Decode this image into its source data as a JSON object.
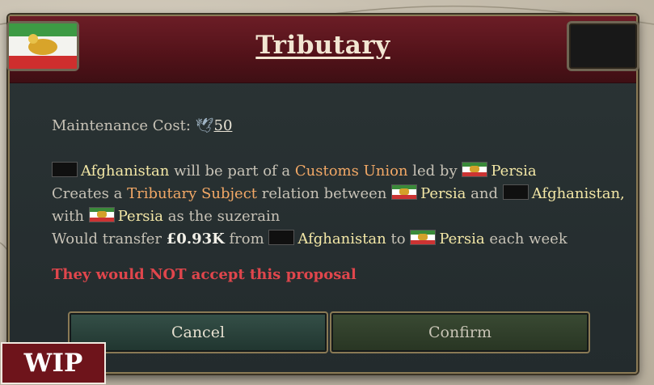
{
  "dialog": {
    "title": "Tributary",
    "maintenance_label": "Maintenance Cost:",
    "maintenance_value": "50",
    "line1": {
      "country_a": "Afghanistan",
      "text1": "will be part of a",
      "union": "Customs Union",
      "text2": "led by",
      "country_b": "Persia"
    },
    "line2": {
      "text1": "Creates a",
      "relation": "Tributary Subject",
      "text2": "relation between",
      "country_b": "Persia",
      "text3": "and",
      "country_a": "Afghanistan,"
    },
    "line3": {
      "text1": "with",
      "country_b": "Persia",
      "text2": "as the suzerain"
    },
    "line4": {
      "text1": "Would transfer",
      "currency": "£",
      "amount": "0.93K",
      "text2": "from",
      "country_a": "Afghanistan",
      "text3": "to",
      "country_b": "Persia",
      "text4": "each week"
    },
    "refusal": "They would NOT accept this proposal",
    "cancel_label": "Cancel",
    "confirm_label": "Confirm"
  },
  "badge": {
    "label": "WIP"
  },
  "icons": {
    "maintenance": "dove-icon",
    "persia_flag": "persia-flag-icon",
    "afghanistan_flag": "afghanistan-flag-icon"
  },
  "colors": {
    "header": "#521219",
    "panel": "#2b3435",
    "highlight_country": "#f3e7a6",
    "highlight_term": "#f2a866",
    "warning": "#e0464c"
  }
}
